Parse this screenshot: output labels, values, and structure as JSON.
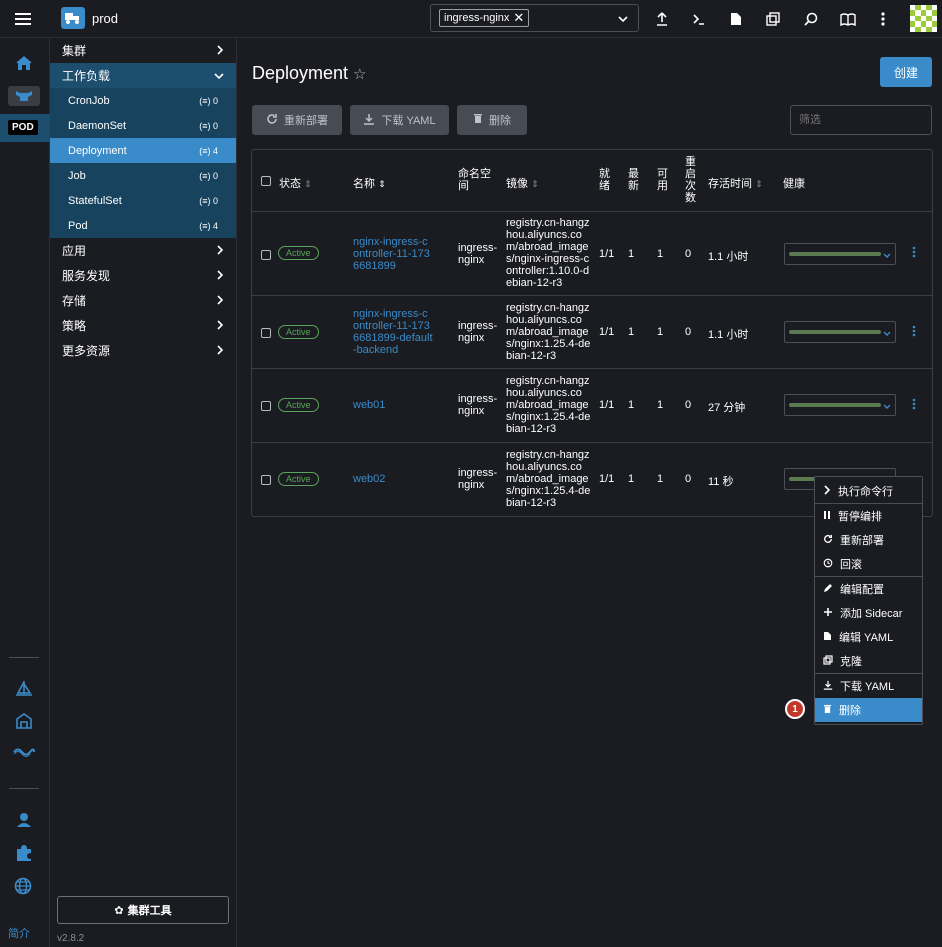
{
  "topbar": {
    "cluster_name": "prod",
    "namespace_tag": "ingress-nginx",
    "icons": [
      "menu-icon",
      "app-logo-icon",
      "upload-icon",
      "terminal-icon",
      "file-icon",
      "copy-icon",
      "search-icon",
      "book-icon",
      "more-vert-icon",
      "avatar"
    ]
  },
  "rail": {
    "pod_badge": "POD",
    "bottom_label": "简介",
    "icons": [
      "home-icon",
      "cluster-icon",
      "helm-icon",
      "fleet-icon",
      "neuvector-icon",
      "user-icon",
      "extension-icon",
      "globe-icon"
    ]
  },
  "nav": {
    "groups_top": [
      {
        "label": "集群"
      }
    ],
    "workload": {
      "label": "工作负载",
      "items": [
        {
          "label": "CronJob",
          "count": "0"
        },
        {
          "label": "DaemonSet",
          "count": "0"
        },
        {
          "label": "Deployment",
          "count": "4"
        },
        {
          "label": "Job",
          "count": "0"
        },
        {
          "label": "StatefulSet",
          "count": "0"
        },
        {
          "label": "Pod",
          "count": "4"
        }
      ]
    },
    "groups_bottom": [
      {
        "label": "应用"
      },
      {
        "label": "服务发现"
      },
      {
        "label": "存储"
      },
      {
        "label": "策略"
      },
      {
        "label": "更多资源"
      }
    ],
    "cluster_tools": "集群工具",
    "version": "v2.8.2"
  },
  "page": {
    "title": "Deployment",
    "create_button": "创建",
    "actions": {
      "redeploy": "重新部署",
      "download_yaml": "下载 YAML",
      "delete": "删除"
    },
    "filter_placeholder": "筛选"
  },
  "table": {
    "headers": [
      "状态",
      "名称",
      "命名空间",
      "镜像",
      "就绪",
      "最新",
      "可用",
      "重启次数",
      "存活时间",
      "健康"
    ],
    "rows": [
      {
        "status": "Active",
        "name": "nginx-ingress-controller-11-1736681899",
        "namespace": "ingress-nginx",
        "image": "registry.cn-hangzhou.aliyuncs.com/abroad_images/nginx-ingress-controller:1.10.0-debian-12-r3",
        "ready": "1/1",
        "uptodate": "1",
        "available": "1",
        "restarts": "0",
        "age": "1.1 小时"
      },
      {
        "status": "Active",
        "name": "nginx-ingress-controller-11-1736681899-default-backend",
        "namespace": "ingress-nginx",
        "image": "registry.cn-hangzhou.aliyuncs.com/abroad_images/nginx:1.25.4-debian-12-r3",
        "ready": "1/1",
        "uptodate": "1",
        "available": "1",
        "restarts": "0",
        "age": "1.1 小时"
      },
      {
        "status": "Active",
        "name": "web01",
        "namespace": "ingress-nginx",
        "image": "registry.cn-hangzhou.aliyuncs.com/abroad_images/nginx:1.25.4-debian-12-r3",
        "ready": "1/1",
        "uptodate": "1",
        "available": "1",
        "restarts": "0",
        "age": "27 分钟"
      },
      {
        "status": "Active",
        "name": "web02",
        "namespace": "ingress-nginx",
        "image": "registry.cn-hangzhou.aliyuncs.com/abroad_images/nginx:1.25.4-debian-12-r3",
        "ready": "1/1",
        "uptodate": "1",
        "available": "1",
        "restarts": "0",
        "age": "11 秒"
      }
    ]
  },
  "context_menu": {
    "items": [
      {
        "label": "执行命令行",
        "icon": "chevron-right-icon"
      },
      {
        "label": "暂停编排",
        "icon": "pause-icon"
      },
      {
        "label": "重新部署",
        "icon": "refresh-icon"
      },
      {
        "label": "回滚",
        "icon": "history-icon"
      },
      {
        "label": "编辑配置",
        "icon": "pencil-icon"
      },
      {
        "label": "添加 Sidecar",
        "icon": "plus-icon"
      },
      {
        "label": "编辑 YAML",
        "icon": "file-icon"
      },
      {
        "label": "克隆",
        "icon": "clone-icon"
      },
      {
        "label": "下载 YAML",
        "icon": "download-icon"
      },
      {
        "label": "删除",
        "icon": "trash-icon"
      }
    ],
    "step_badge": "1"
  },
  "colors": {
    "bg": "#1b1c21",
    "accent": "#3a8bc9",
    "nav_active": "#1d4e6e",
    "active_badge": "#5aa35a",
    "health_bar": "#5b7a52"
  }
}
